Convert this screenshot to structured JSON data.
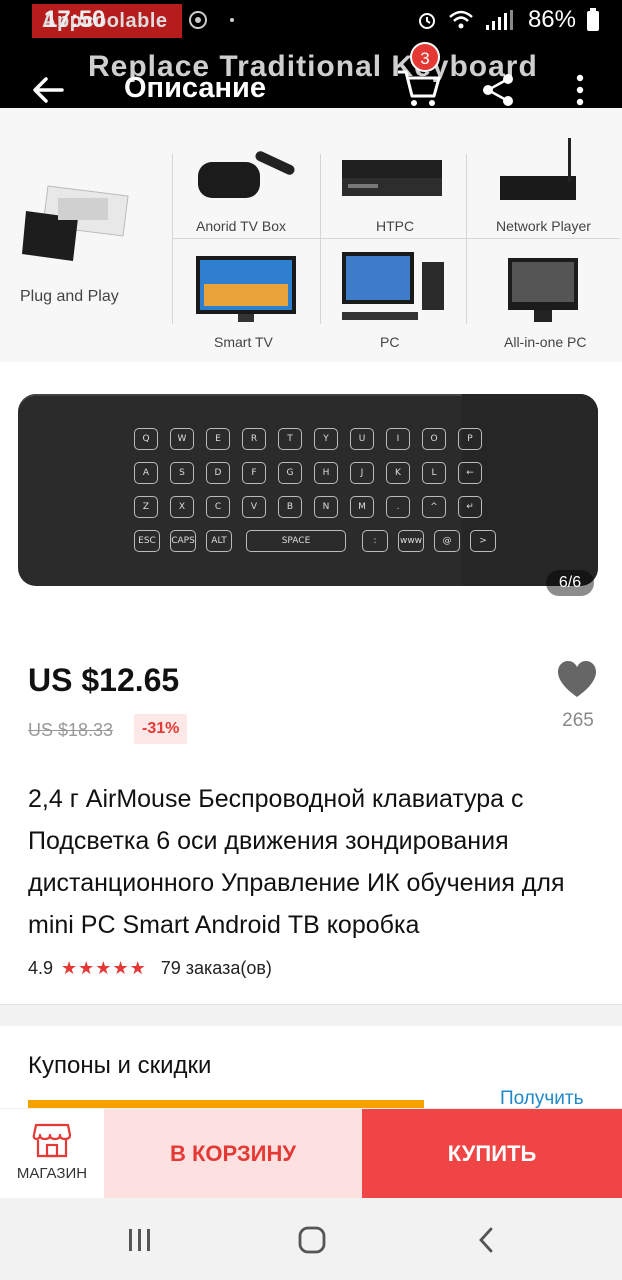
{
  "status_bar": {
    "app_label": "Appcoolable",
    "time": "17:50",
    "battery": "86%"
  },
  "app_bar": {
    "banner_text": "Replace Traditional Keyboard",
    "title": "Описание",
    "cart_count": "3"
  },
  "gallery": {
    "devices": [
      {
        "label": "Plug and Play"
      },
      {
        "label": "Anorid TV Box"
      },
      {
        "label": "HTPC"
      },
      {
        "label": "Network Player"
      },
      {
        "label": "Smart TV"
      },
      {
        "label": "PC"
      },
      {
        "label": "All-in-one PC"
      }
    ],
    "keys_row1": [
      "Q",
      "W",
      "E",
      "R",
      "T",
      "Y",
      "U",
      "I",
      "O",
      "P"
    ],
    "keys_row2": [
      "A",
      "S",
      "D",
      "F",
      "G",
      "H",
      "J",
      "K",
      "L",
      "←"
    ],
    "keys_row3": [
      "Z",
      "X",
      "C",
      "V",
      "B",
      "N",
      "M",
      ".",
      "^",
      "↵"
    ],
    "keys_row4": [
      "ESC",
      "CAPS",
      "ALT",
      "SPACE",
      ":",
      "www",
      "@",
      ">"
    ],
    "page_indicator": "6/6"
  },
  "product": {
    "price": "US $12.65",
    "old_price": "US $18.33",
    "discount": "-31%",
    "wishlist_count": "265",
    "title": "2,4 г AirMouse Беспроводной клавиатура с Подсветка 6 оси движения зондирования дистанционного Управление ИК обучения для mini PC Smart Android ТВ коробка",
    "rating": "4.9",
    "stars": "★★★★★",
    "orders": "79 заказа(ов)"
  },
  "coupons": {
    "title": "Купоны и скидки",
    "get_label": "Получить"
  },
  "actions": {
    "store_label": "МАГАЗИН",
    "add_to_cart": "В КОРЗИНУ",
    "buy": "КУПИТЬ"
  },
  "colors": {
    "accent": "#e53935",
    "buy_button": "#f04545",
    "cart_button_bg": "#fde1e1",
    "link": "#1e88c8",
    "coupon_bar": "#f5a200"
  }
}
